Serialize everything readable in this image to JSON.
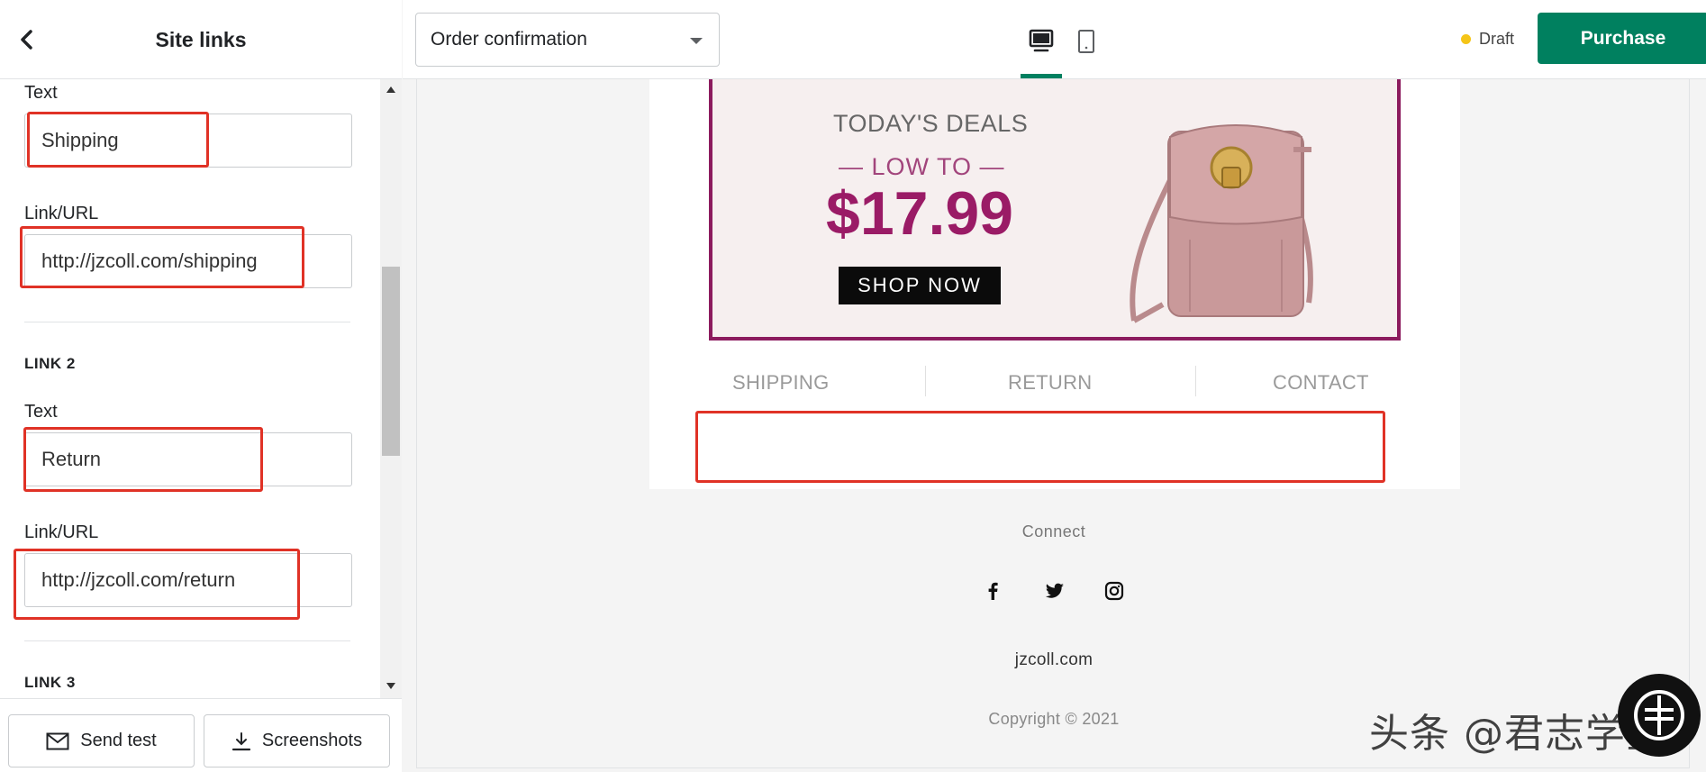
{
  "sidebar": {
    "title": "Site links",
    "link1": {
      "text_label": "Text",
      "text_value": "Shipping",
      "url_label": "Link/URL",
      "url_value": "http://jzcoll.com/shipping"
    },
    "link2": {
      "section_label": "LINK 2",
      "text_label": "Text",
      "text_value": "Return",
      "url_label": "Link/URL",
      "url_value": "http://jzcoll.com/return"
    },
    "link3": {
      "section_label": "LINK 3"
    },
    "footer": {
      "send_test_label": "Send test",
      "screenshots_label": "Screenshots"
    }
  },
  "topbar": {
    "template_select": "Order confirmation",
    "active_view": "desktop",
    "status_label": "Draft",
    "purchase_label": "Purchase"
  },
  "preview": {
    "banner": {
      "headline": "TODAY'S DEALS",
      "subline": "— LOW TO —",
      "price": "$17.99",
      "cta": "SHOP NOW"
    },
    "site_links": [
      "SHIPPING",
      "RETURN",
      "CONTACT"
    ],
    "connect_label": "Connect",
    "social_icons": [
      "facebook-icon",
      "twitter-icon",
      "instagram-icon"
    ],
    "domain": "jzcoll.com",
    "copyright": "Copyright © 2021"
  },
  "watermark": {
    "text": "头条 @君志学堂"
  },
  "colors": {
    "accent": "#008060",
    "annotation_red": "#e03226",
    "banner_border": "#8c1b5e",
    "price": "#9a1b66",
    "draft_dot": "#f5c518"
  }
}
